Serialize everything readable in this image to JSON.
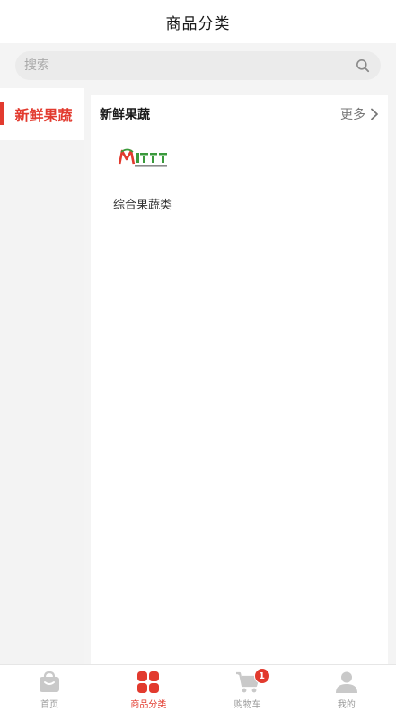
{
  "header": {
    "title": "商品分类"
  },
  "search": {
    "placeholder": "搜索"
  },
  "sidebar": {
    "items": [
      {
        "label": "新鲜果蔬",
        "active": true
      }
    ]
  },
  "section": {
    "title": "新鲜果蔬",
    "more_label": "更多",
    "items": [
      {
        "label": "综合果蔬类",
        "logo": "brand-logo-icon"
      }
    ]
  },
  "tabbar": {
    "tabs": [
      {
        "label": "首页",
        "icon": "home-bag-icon",
        "active": false
      },
      {
        "label": "商品分类",
        "icon": "category-grid-icon",
        "active": true
      },
      {
        "label": "购物车",
        "icon": "cart-icon",
        "active": false,
        "badge": "1"
      },
      {
        "label": "我的",
        "icon": "user-icon",
        "active": false
      }
    ]
  },
  "colors": {
    "accent": "#e23a2e",
    "inactive": "#999999",
    "background": "#f4f4f4"
  }
}
